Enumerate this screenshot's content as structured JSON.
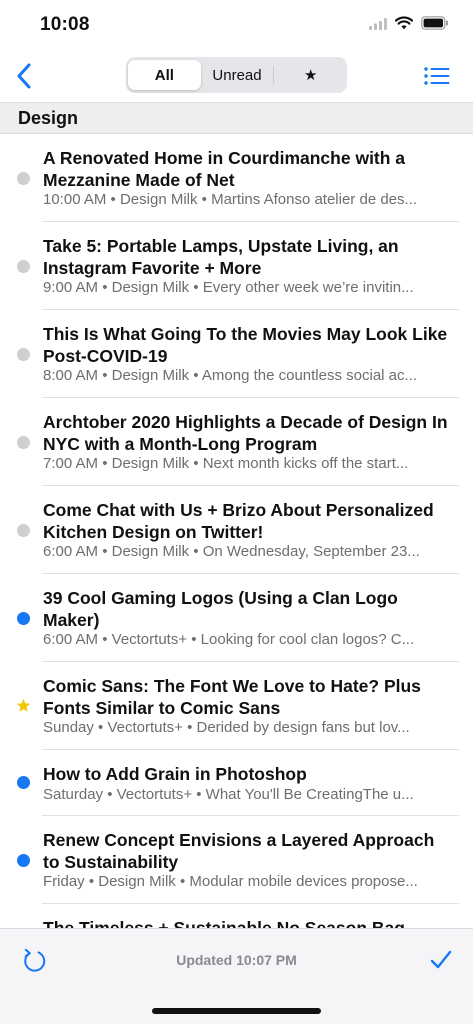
{
  "status_bar": {
    "time": "10:08"
  },
  "nav": {
    "segments": [
      {
        "label": "All",
        "active": true
      },
      {
        "label": "Unread",
        "active": false
      },
      {
        "label": "★",
        "active": false
      }
    ]
  },
  "section": {
    "title": "Design"
  },
  "articles": [
    {
      "title": "A Renovated Home in Courdimanche with a Mezzanine Made of Net",
      "meta": "10:00 AM • Design Milk • Martins Afonso atelier de des...",
      "state": "read"
    },
    {
      "title": "Take 5: Portable Lamps, Upstate Living, an Instagram Favorite + More",
      "meta": "9:00 AM • Design Milk • Every other week we’re invitin...",
      "state": "read"
    },
    {
      "title": "This Is What Going To the Movies May Look Like Post-COVID-19",
      "meta": "8:00 AM • Design Milk • Among the countless social ac...",
      "state": "read"
    },
    {
      "title": "Archtober 2020 Highlights a Decade of Design In NYC with a Month-Long Program",
      "meta": "7:00 AM • Design Milk • Next month kicks off the start...",
      "state": "read"
    },
    {
      "title": "Come Chat with Us + Brizo About Personalized Kitchen Design on Twitter!",
      "meta": "6:00 AM • Design Milk • On Wednesday, September 23...",
      "state": "read"
    },
    {
      "title": "39 Cool Gaming Logos (Using a Clan Logo Maker)",
      "meta": "6:00 AM • Vectortuts+ • Looking for cool clan logos? C...",
      "state": "unread"
    },
    {
      "title": "Comic Sans: The Font We Love to Hate? Plus Fonts Similar to Comic Sans",
      "meta": "Sunday • Vectortuts+ • Derided by design fans but lov...",
      "state": "starred"
    },
    {
      "title": "How to Add Grain in Photoshop",
      "meta": "Saturday • Vectortuts+ • What You'll Be CreatingThe u...",
      "state": "unread"
    },
    {
      "title": "Renew Concept Envisions a Layered Approach to Sustainability",
      "meta": "Friday • Design Milk • Modular mobile devices propose...",
      "state": "unread"
    },
    {
      "title": "The Timeless + Sustainable No Season Bag",
      "meta": "",
      "state": "read"
    }
  ],
  "toolbar": {
    "updated_text": "Updated 10:07 PM"
  },
  "colors": {
    "accent": "#1877f2",
    "unread_dot": "#1877f2",
    "read_dot": "#cfcfd2",
    "star": "#f5c400"
  }
}
